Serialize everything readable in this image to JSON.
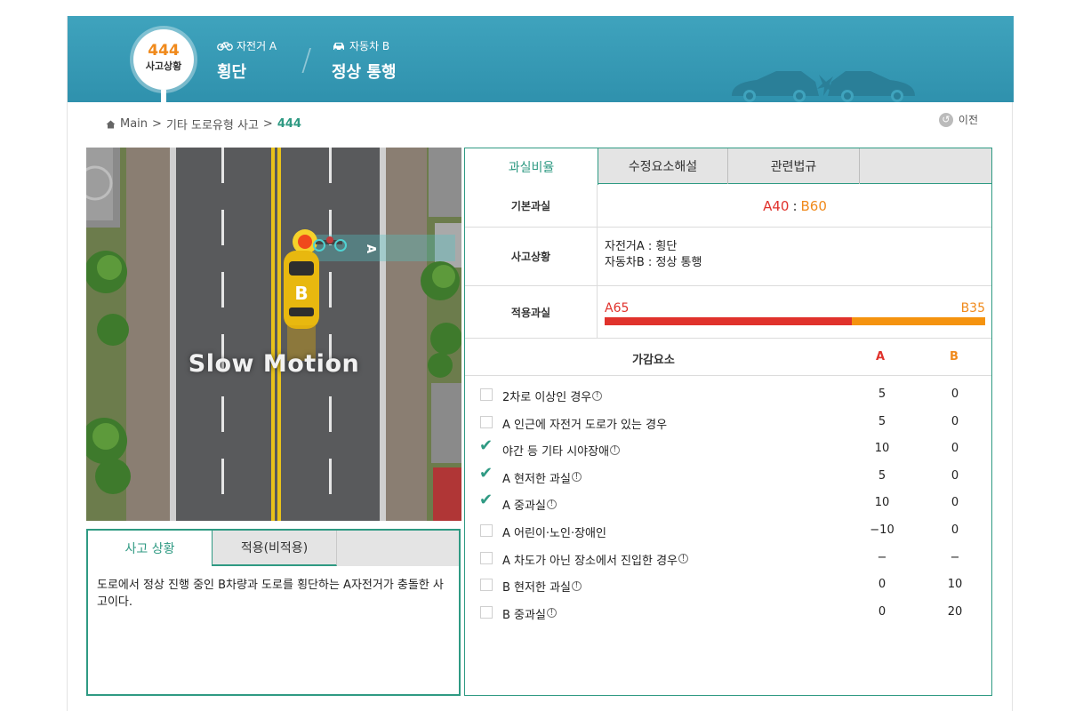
{
  "header": {
    "case_number": "444",
    "case_label": "사고상황",
    "party_a": {
      "label": "자전거 A",
      "action": "횡단",
      "icon": "bicycle-icon"
    },
    "party_b": {
      "label": "자동차 B",
      "action": "정상 통행",
      "icon": "car-icon"
    }
  },
  "breadcrumb": {
    "home_icon": "home-icon",
    "items": [
      "Main",
      "기타 도로유형 사고",
      "444"
    ],
    "separator": ">"
  },
  "prev_button": {
    "label": "이전",
    "icon": "back-arrow-icon"
  },
  "scene": {
    "overlay_text": "Slow Motion",
    "car_a_label": "A",
    "car_b_label": "B"
  },
  "left_tabs": [
    {
      "label": "사고 상황",
      "active": true
    },
    {
      "label": "적용(비적용)",
      "active": false
    }
  ],
  "description": "도로에서 정상 진행 중인 B차량과 도로를 횡단하는 A자전거가 충돌한 사고이다.",
  "right_tabs": [
    {
      "label": "과실비율",
      "active": true
    },
    {
      "label": "수정요소해설",
      "active": false
    },
    {
      "label": "관련법규",
      "active": false
    }
  ],
  "fault": {
    "base_label": "기본과실",
    "base_a": "A40",
    "base_sep": ":",
    "base_b": "B60",
    "situation_label": "사고상황",
    "situation_a": "자전거A : 횡단",
    "situation_b": "자동차B : 정상 통행",
    "applied_label": "적용과실",
    "applied_a": "A65",
    "applied_b": "B35",
    "applied_a_fraction": 0.65
  },
  "adjust_header": {
    "name": "가감요소",
    "a": "A",
    "b": "B"
  },
  "adjustments": [
    {
      "name": "2차로 이상인 경우",
      "info": true,
      "checked": false,
      "a": "5",
      "b": "0"
    },
    {
      "name": "A 인근에 자전거 도로가 있는 경우",
      "info": false,
      "checked": false,
      "a": "5",
      "b": "0"
    },
    {
      "name": "야간 등 기타 시야장애",
      "info": true,
      "checked": true,
      "a": "10",
      "b": "0"
    },
    {
      "name": "A 현저한 과실",
      "info": true,
      "checked": true,
      "a": "5",
      "b": "0"
    },
    {
      "name": "A 중과실",
      "info": true,
      "checked": true,
      "a": "10",
      "b": "0"
    },
    {
      "name": "A 어린이·노인·장애인",
      "info": false,
      "checked": false,
      "a": "−10",
      "b": "0"
    },
    {
      "name": "A 차도가 아닌 장소에서 진입한 경우",
      "info": true,
      "checked": false,
      "a": "−",
      "b": "−"
    },
    {
      "name": "B 현저한 과실",
      "info": true,
      "checked": false,
      "a": "0",
      "b": "10"
    },
    {
      "name": "B 중과실",
      "info": true,
      "checked": false,
      "a": "0",
      "b": "20"
    }
  ],
  "colors": {
    "teal": "#2f9a83",
    "header": "#3fa3bd",
    "a": "#e0322c",
    "b": "#f08a1c"
  }
}
